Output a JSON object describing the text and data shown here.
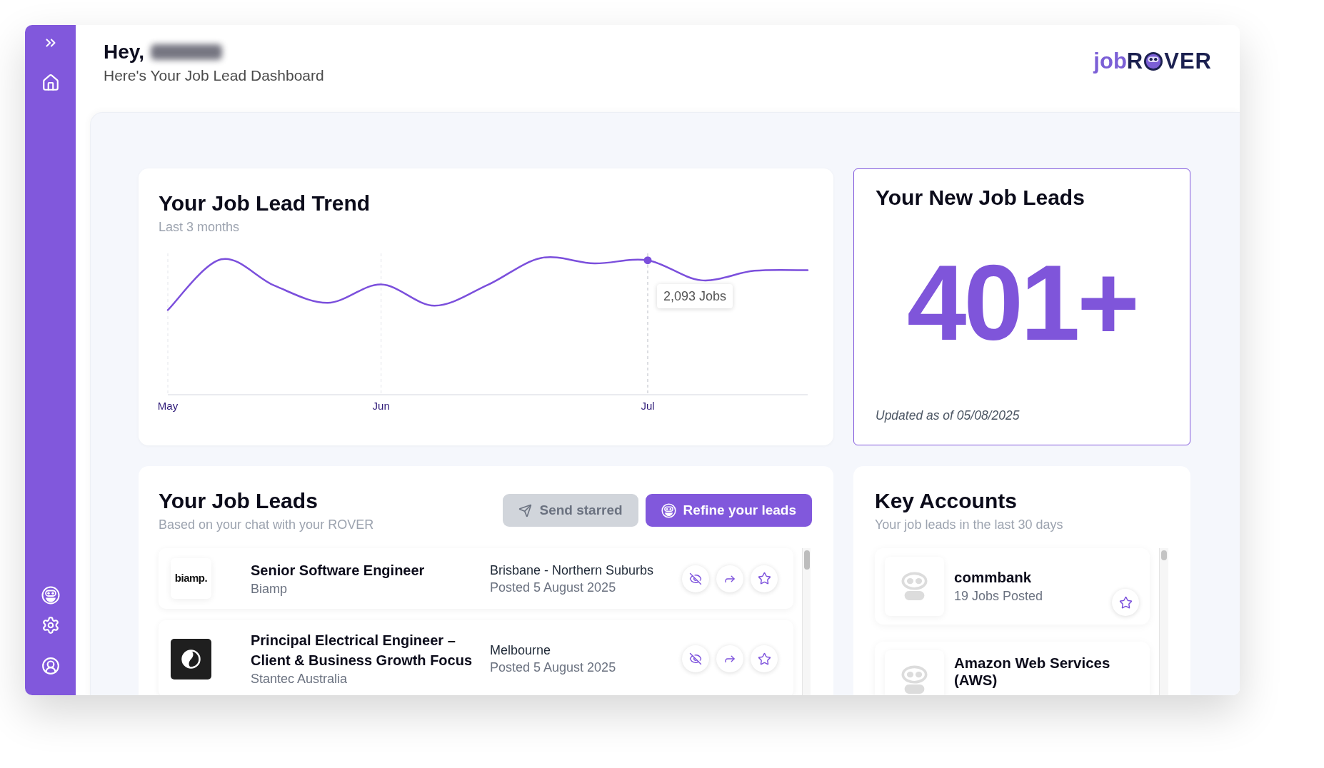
{
  "header": {
    "greeting": "Hey,",
    "subtitle": "Here's Your Job Lead Dashboard"
  },
  "logo": {
    "prefix": "job",
    "initial": "R",
    "suffix": "VER"
  },
  "trend": {
    "title": "Your Job Lead Trend",
    "subtitle": "Last 3 months",
    "axis_labels": [
      "May",
      "Jun",
      "Jul"
    ],
    "tooltip": "2,093 Jobs"
  },
  "new_leads": {
    "title": "Your New Job Leads",
    "count": "401+",
    "updated": "Updated as of 05/08/2025"
  },
  "job_leads": {
    "title": "Your Job Leads",
    "subtitle": "Based on your chat with your ROVER",
    "buttons": [
      {
        "kind": "send",
        "label": "Send starred",
        "disabled": true
      },
      {
        "kind": "refine",
        "label": "Refine your leads",
        "disabled": false
      }
    ],
    "rows": [
      {
        "logo": {
          "kind": "wordmark",
          "text": "biamp."
        },
        "title": "Senior Software Engineer",
        "company": "Biamp",
        "location": "Brisbane - Northern Suburbs",
        "posted": "Posted 5 August 2025",
        "starred": false
      },
      {
        "logo": {
          "kind": "emblem"
        },
        "title": "Principal Electrical Engineer – Client & Business Growth Focus",
        "company": "Stantec Australia",
        "location": "Melbourne",
        "posted": "Posted 5 August 2025",
        "starred": false
      }
    ]
  },
  "key_accounts": {
    "title": "Key Accounts",
    "subtitle": "Your job leads in the last 30 days",
    "accounts": [
      {
        "name": "commbank",
        "jobs": "19 Jobs Posted",
        "starred": false
      },
      {
        "name": "Amazon Web Services (AWS)"
      }
    ]
  }
}
